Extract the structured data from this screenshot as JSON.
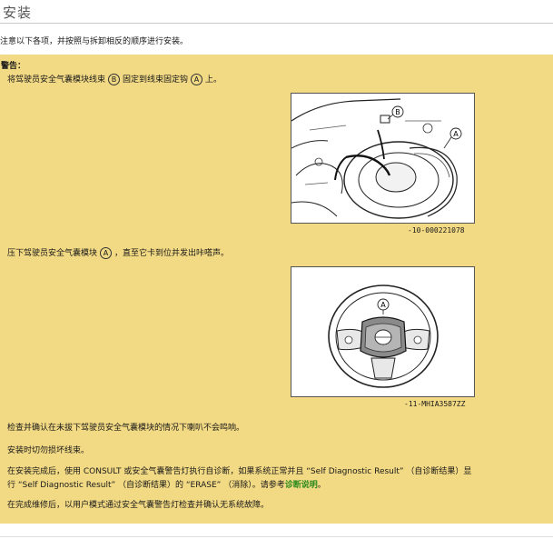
{
  "page": {
    "title": "安装",
    "intro": "注意以下各项，并按照与拆卸相反的顺序进行安装。"
  },
  "warning": {
    "label": "警告：",
    "step1_pre": "将驾驶员安全气囊模块线束",
    "callout_b": "B",
    "step1_mid": "固定到线束固定钩",
    "callout_a": "A",
    "step1_post": "上。",
    "fig1_callout_a": "A",
    "fig1_callout_b": "B",
    "fig1_caption": "-10-000221078",
    "step2_pre": "压下驾驶员安全气囊模块",
    "step2_callout": "A",
    "step2_post": "，直至它卡到位并发出咔嗒声。",
    "fig2_callout_a": "A",
    "fig2_caption": "-11-MHIA3587ZZ",
    "para3": "检查并确认在未拔下驾驶员安全气囊模块的情况下喇叭不会鸣响。",
    "para4": "安装时切勿损坏线束。",
    "para5_line1": "在安装完成后，使用 CONSULT 或安全气囊警告灯执行自诊断，如果系统正常并且 “Self Diagnostic Result” （自诊断结果）显",
    "para5_line2_pre": "行 “Self Diagnostic Result” （自诊断结果）的 “ERASE” （消除）。请参考",
    "para5_link": "诊断说明",
    "para5_line2_post": "。",
    "para6": "在完成维修后，以用户模式通过安全气囊警告灯检查并确认无系统故障。"
  },
  "colors": {
    "warning_bg": "#f2d983",
    "link": "#2e8b1e"
  }
}
